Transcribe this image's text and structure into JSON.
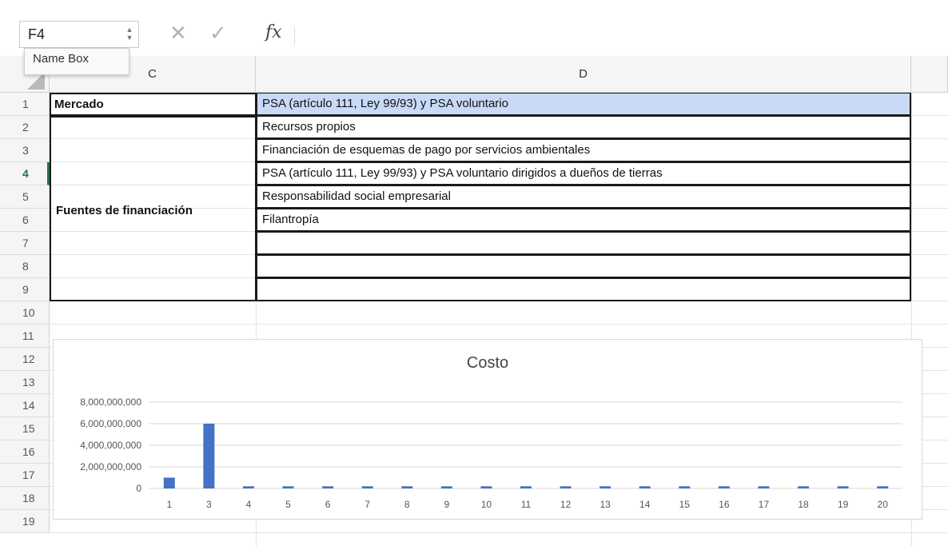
{
  "formula_bar": {
    "name_box_value": "F4",
    "name_box_tooltip": "Name Box",
    "cancel_glyph": "✕",
    "enter_glyph": "✓",
    "fx_label": "fx",
    "formula_value": ""
  },
  "columns": [
    {
      "label": "C"
    },
    {
      "label": "D"
    }
  ],
  "rows": [
    "1",
    "2",
    "3",
    "4",
    "5",
    "6",
    "7",
    "8",
    "9",
    "10",
    "11",
    "12",
    "13",
    "14",
    "15",
    "16",
    "17",
    "18",
    "19"
  ],
  "active_row": "4",
  "cells": {
    "c1": "Mercado",
    "c_merged": "Fuentes de financiación",
    "d": [
      "PSA (artículo 111, Ley 99/93) y PSA voluntario",
      "Recursos propios",
      "Financiación de esquemas de pago por servicios ambientales",
      "PSA (artículo 111, Ley 99/93) y PSA voluntario dirigidos a dueños de tierras",
      "Responsabilidad social empresarial",
      "Filantropía",
      "",
      "",
      ""
    ]
  },
  "chart_data": {
    "type": "bar",
    "title": "Costo",
    "categories": [
      "1",
      "3",
      "4",
      "5",
      "6",
      "7",
      "8",
      "9",
      "10",
      "11",
      "12",
      "13",
      "14",
      "15",
      "16",
      "17",
      "18",
      "19",
      "20"
    ],
    "values": [
      1000000000,
      6000000000,
      200000000,
      200000000,
      200000000,
      200000000,
      200000000,
      200000000,
      200000000,
      200000000,
      200000000,
      200000000,
      200000000,
      200000000,
      200000000,
      200000000,
      200000000,
      200000000,
      200000000
    ],
    "ylim": [
      0,
      8000000000
    ],
    "yticks": [
      "0",
      "2,000,000,000",
      "4,000,000,000",
      "6,000,000,000",
      "8,000,000,000"
    ],
    "xlabel": "",
    "ylabel": "",
    "bar_color": "#4472c4",
    "grid": true
  },
  "colors": {
    "selected_fill": "#c9daf8",
    "active_row_accent": "#217346"
  }
}
